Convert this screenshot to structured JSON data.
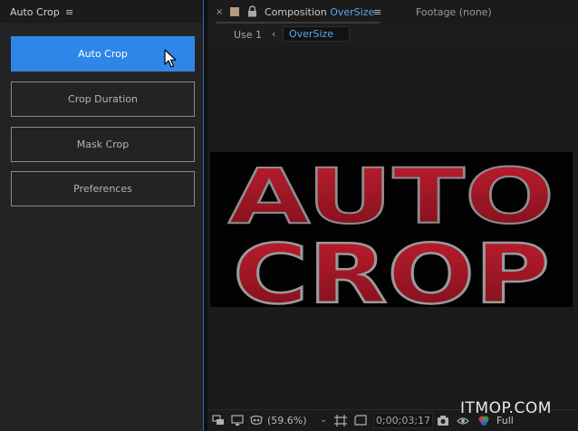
{
  "left_panel": {
    "tab_title": "Auto Crop",
    "menu_glyph": "≡",
    "buttons": {
      "auto_crop": "Auto Crop",
      "crop_duration": "Crop Duration",
      "mask_crop": "Mask Crop",
      "preferences": "Preferences"
    },
    "accent_color": "#2e87e6"
  },
  "right_panel": {
    "close_glyph": "×",
    "composition_tab": {
      "prefix": "Composition ",
      "name": "OverSize",
      "menu_glyph": "≡"
    },
    "footage_tab": "Footage  (none)",
    "breadcrumb": {
      "previous": "Use 1",
      "arrow": "‹",
      "current": "OverSize"
    },
    "canvas_text": {
      "line1": "AUTO",
      "line2": "CROP",
      "fill_color": "#a01828"
    },
    "toolbar": {
      "zoom": "(59.6%)",
      "zoom_caret": "⌄",
      "timecode": "0;00;03;17",
      "resolution": "Full"
    }
  },
  "watermark": "ITMOP.COM"
}
